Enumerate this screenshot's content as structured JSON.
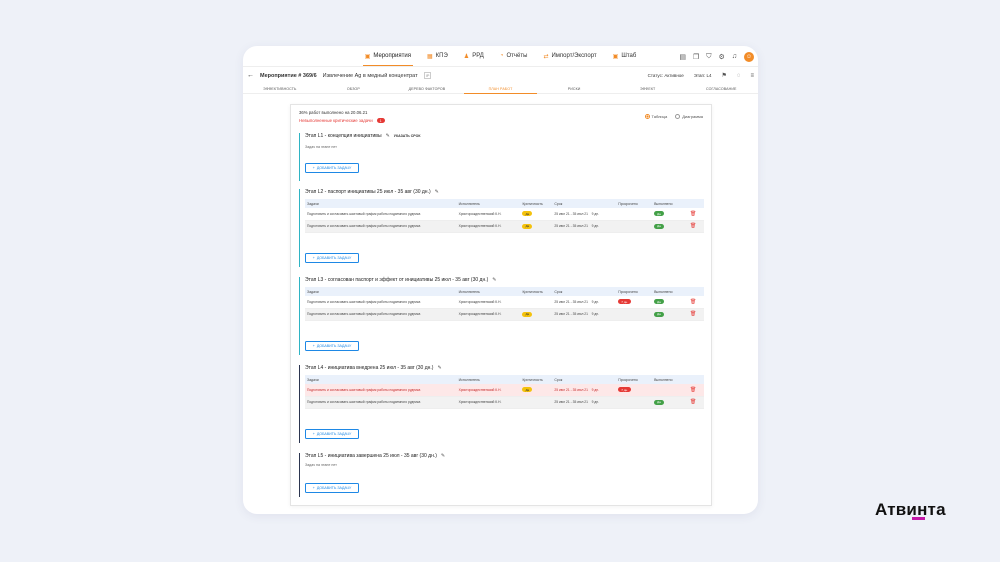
{
  "nav": {
    "items": [
      {
        "icon": "calendar-icon",
        "label": "Мероприятия",
        "active": true
      },
      {
        "icon": "grid-icon",
        "label": "КПЭ"
      },
      {
        "icon": "people-icon",
        "label": "РРД"
      },
      {
        "icon": "chart-icon",
        "label": "Отчёты"
      },
      {
        "icon": "sync-icon",
        "label": "Импорт/Экспорт"
      },
      {
        "icon": "calendar-icon",
        "label": "Штаб"
      }
    ]
  },
  "header": {
    "title": "Мероприятие # 369/6",
    "subtitle": "Извлечение Ag в медный концентрат",
    "tag": "IP",
    "status": "Статус: Активное",
    "stage": "Этап: L4"
  },
  "tabs": [
    "Эффективность",
    "Обзор",
    "Дерево факторов",
    "План работ",
    "Риски",
    "Эффект",
    "Согласование"
  ],
  "active_tab": 3,
  "summary": {
    "progress_text": "36% работ выполнено на 20.06.21",
    "critical_text": "Невыполненные критические задачи",
    "critical_count": "1"
  },
  "view_toggle": {
    "table_label": "Таблица",
    "diagram_label": "Диаграмма",
    "selected": "table"
  },
  "columns": [
    "Задачи",
    "Исполнитель",
    "Критичность",
    "Срок",
    "Просрочено",
    "Выполнено"
  ],
  "add_task_label": "Добавить задачу",
  "stages": [
    {
      "title": "Этап L1 - концепция инициативы",
      "deadline_label": "Указать срок",
      "empty_text": "Задач на этапе нет",
      "rows": []
    },
    {
      "title": "Этап L2 - паспорт инициативы 25 июл - 35 авг (30 дн.)",
      "rows": [
        {
          "task": "Подготовить и согласовать шахтовый график работы подземного рудника",
          "owner": "Христорождественский К.Н.",
          "crit": "Да",
          "due": "25 июл 21 - 35 июл 21",
          "days": "9 дн.",
          "overdue": "",
          "done": "Да",
          "style": ""
        },
        {
          "task": "Подготовить и согласовать шахтовый график работы подземного рудника",
          "owner": "Христорождественский К.Н.",
          "crit": "Да",
          "due": "25 июл 21 - 35 июл 21",
          "days": "9 дн.",
          "overdue": "",
          "done": "Да",
          "style": "alt"
        }
      ]
    },
    {
      "title": "Этап L3 - согласован паспорт и эффект от инициативы 25 июл - 35 авг (30 дн.)",
      "rows": [
        {
          "task": "Подготовить и согласовать шахтовый график работы подземного рудника",
          "owner": "Христорождественский К.Н.",
          "crit": "",
          "due": "25 июл 21 - 35 июл 21",
          "days": "9 дн.",
          "overdue": "7 дн.",
          "done": "Да",
          "style": ""
        },
        {
          "task": "Подготовить и согласовать шахтовый график работы подземного рудника",
          "owner": "Христорождественский К.Н.",
          "crit": "Да",
          "due": "25 июл 21 - 35 июл 21",
          "days": "9 дн.",
          "overdue": "",
          "done": "Да",
          "style": "alt"
        }
      ]
    },
    {
      "title": "Этап L4 - инициатива внедрена 25 июл - 35 авг (30 дн.)",
      "rows": [
        {
          "task": "Подготовить и согласовать шахтовый график работы подземного рудника",
          "owner": "Христорождественский К.Н.",
          "crit": "Да",
          "due": "25 июл 21 - 35 июл 21",
          "days": "9 дн.",
          "overdue": "7 дн.",
          "done": "",
          "style": "red"
        },
        {
          "task": "Подготовить и согласовать шахтовый график работы подземного рудника",
          "owner": "Христорождественский К.Н.",
          "crit": "",
          "due": "25 июл 21 - 35 июл 21",
          "days": "9 дн.",
          "overdue": "",
          "done": "Да",
          "style": "alt"
        }
      ]
    },
    {
      "title": "Этап L5 - инициатива завершена 25 июл - 35 авг (30 дн.)",
      "empty_text": "Задач на этапе нет",
      "rows": []
    }
  ],
  "brand": {
    "logo_text": "Атвинта",
    "accent": "#f28c28",
    "bar_color": "#c318a8"
  }
}
